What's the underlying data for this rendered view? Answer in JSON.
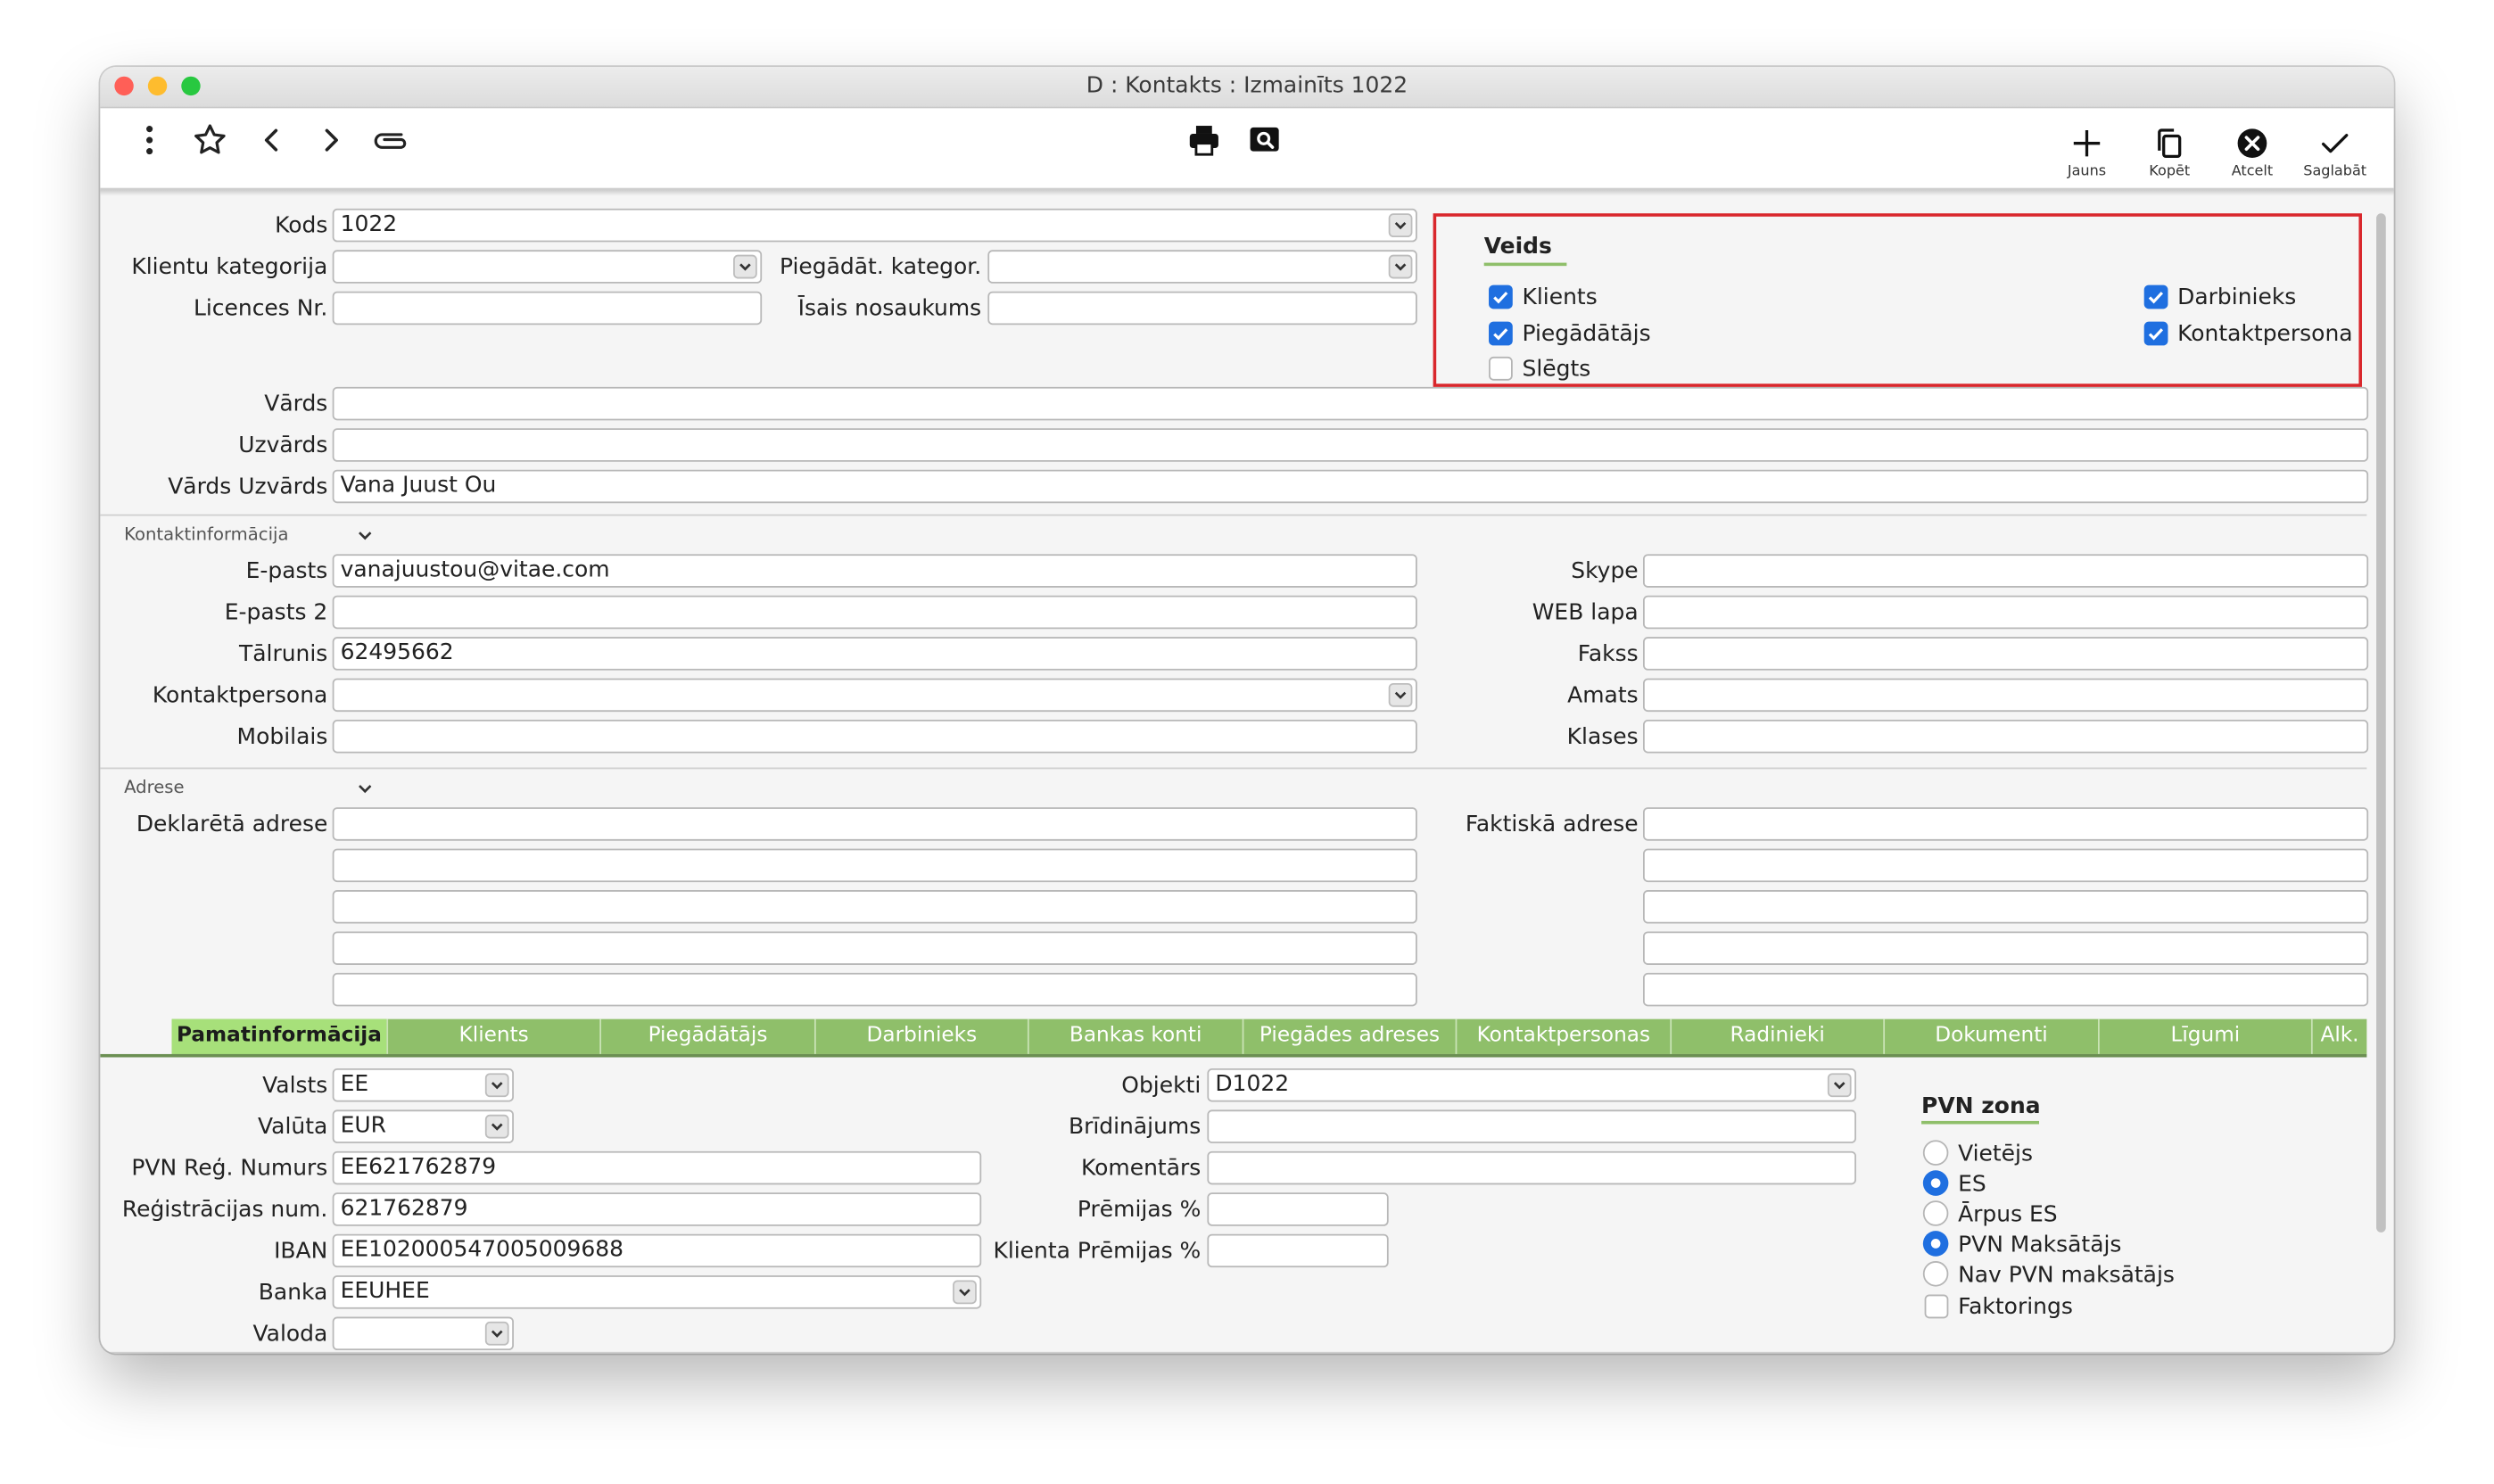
{
  "window": {
    "title": "D : Kontakts : Izmainīts 1022",
    "traffic_colors": [
      "#ff5f57",
      "#febc2e",
      "#28c840"
    ]
  },
  "toolbar": {
    "left_icons": [
      "more-vertical-icon",
      "star-icon",
      "chevron-left-icon",
      "chevron-right-icon",
      "paperclip-icon"
    ],
    "center_icons": [
      "print-icon",
      "preview-icon"
    ],
    "new_label": "Jauns",
    "copy_label": "Kopēt",
    "cancel_label": "Atcelt",
    "save_label": "Saglabāt"
  },
  "header": {
    "kods_label": "Kods",
    "kods_value": "1022",
    "klientu_kategorija_label": "Klientu kategorija",
    "klientu_kategorija_value": "",
    "piegadat_kategor_label": "Piegādāt. kategor.",
    "piegadat_kategor_value": "",
    "licences_label": "Licences Nr.",
    "licences_value": "",
    "isais_label": "Īsais nosaukums",
    "isais_value": "",
    "vards_label": "Vārds",
    "vards_value": "",
    "uzvards_label": "Uzvārds",
    "uzvards_value": "",
    "vards_uzvards_label": "Vārds Uzvārds",
    "vards_uzvards_value": "Vana Juust Ou"
  },
  "veids": {
    "title": "Veids",
    "klients": {
      "label": "Klients",
      "checked": true
    },
    "piegadatajs": {
      "label": "Piegādātājs",
      "checked": true
    },
    "slegts": {
      "label": "Slēgts",
      "checked": false
    },
    "darbinieks": {
      "label": "Darbinieks",
      "checked": true
    },
    "kontaktpersona": {
      "label": "Kontaktpersona",
      "checked": true
    }
  },
  "kontakt": {
    "section_title": "Kontaktinformācija",
    "epasts_label": "E-pasts",
    "epasts_value": "vanajuustou@vitae.com",
    "epasts2_label": "E-pasts 2",
    "epasts2_value": "",
    "talrunis_label": "Tālrunis",
    "talrunis_value": "62495662",
    "kontaktpersona_label": "Kontaktpersona",
    "kontaktpersona_value": "",
    "mobilais_label": "Mobilais",
    "mobilais_value": "",
    "skype_label": "Skype",
    "web_label": "WEB lapa",
    "fakss_label": "Fakss",
    "amats_label": "Amats",
    "klases_label": "Klases"
  },
  "adrese": {
    "section_title": "Adrese",
    "deklareta_label": "Deklarētā adrese",
    "faktiska_label": "Faktiskā adrese"
  },
  "tabs": [
    "Pamatinformācija",
    "Klients",
    "Piegādātājs",
    "Darbinieks",
    "Bankas konti",
    "Piegādes adreses",
    "Kontaktpersonas",
    "Radinieki",
    "Dokumenti",
    "Līgumi",
    "Alk."
  ],
  "pamat": {
    "valsts_label": "Valsts",
    "valsts_value": "EE",
    "valuta_label": "Valūta",
    "valuta_value": "EUR",
    "pvn_reg_label": "PVN Reģ. Numurs",
    "pvn_reg_value": "EE621762879",
    "reg_num_label": "Reģistrācijas num.",
    "reg_num_value": "621762879",
    "iban_label": "IBAN",
    "iban_value": "EE102000547005009688",
    "banka_label": "Banka",
    "banka_value": "EEUHEE",
    "valoda_label": "Valoda",
    "valoda_value": "",
    "objekti_label": "Objekti",
    "objekti_value": "D1022",
    "bridinajums_label": "Brīdinājums",
    "bridinajums_value": "",
    "komentars_label": "Komentārs",
    "komentars_value": "",
    "premijas_label": "Prēmijas %",
    "premijas_value": "",
    "klienta_premijas_label": "Klienta Prēmijas %",
    "klienta_premijas_value": ""
  },
  "pvn_zona": {
    "title": "PVN zona",
    "options": [
      {
        "label": "Vietējs",
        "selected": false
      },
      {
        "label": "ES",
        "selected": true
      },
      {
        "label": "Ārpus ES",
        "selected": false
      },
      {
        "label": "PVN Maksātājs",
        "selected": true
      },
      {
        "label": "Nav PVN maksātājs",
        "selected": false
      }
    ],
    "faktorings": {
      "label": "Faktorings",
      "checked": false
    }
  }
}
